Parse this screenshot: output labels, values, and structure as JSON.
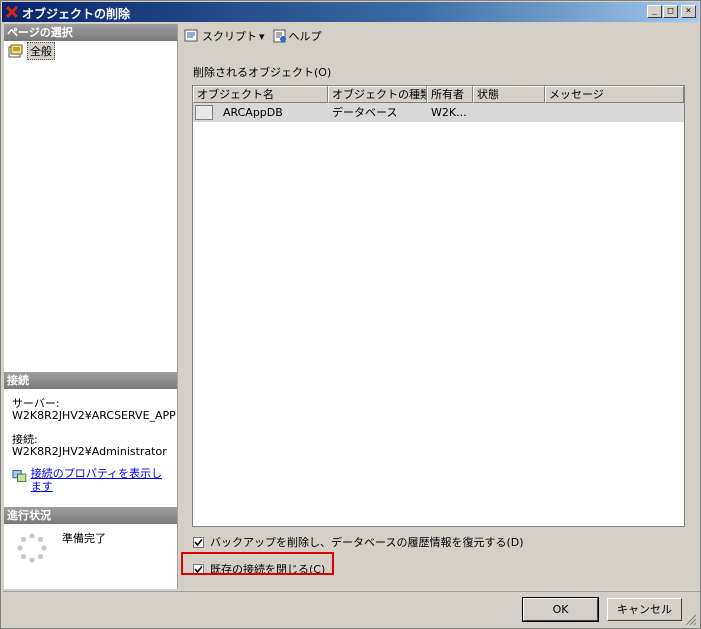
{
  "window": {
    "title": "オブジェクトの削除"
  },
  "caption": {
    "minimize": "_",
    "maximize": "□",
    "close": "×"
  },
  "left": {
    "pages_header": "ページの選択",
    "pages": [
      {
        "label": "全般"
      }
    ],
    "connection_header": "接続",
    "server_label": "サーバー:",
    "server_value": "W2K8R2JHV2¥ARCSERVE_APP",
    "connection_label": "接続:",
    "connection_value": "W2K8R2JHV2¥Administrator",
    "connection_props_link": "接続のプロパティを表示します",
    "progress_header": "進行状況",
    "progress_status": "準備完了"
  },
  "toolbar": {
    "script_label": "スクリプト",
    "script_arrow": "▾",
    "help_label": "ヘルプ"
  },
  "main": {
    "objects_label": "削除されるオブジェクト(O)",
    "columns": [
      "オブジェクト名",
      "オブジェクトの種類",
      "所有者",
      "状態",
      "メッセージ"
    ],
    "rows": [
      {
        "name": "ARCAppDB",
        "type": "データベース",
        "owner": "W2K...",
        "status": "",
        "message": ""
      }
    ],
    "delete_backup_label": "バックアップを削除し、データベースの履歴情報を復元する(D)",
    "close_connections_label": "既存の接続を閉じる(C)",
    "delete_backup_checked": true,
    "close_connections_checked": true
  },
  "buttons": {
    "ok": "OK",
    "cancel": "キャンセル"
  }
}
